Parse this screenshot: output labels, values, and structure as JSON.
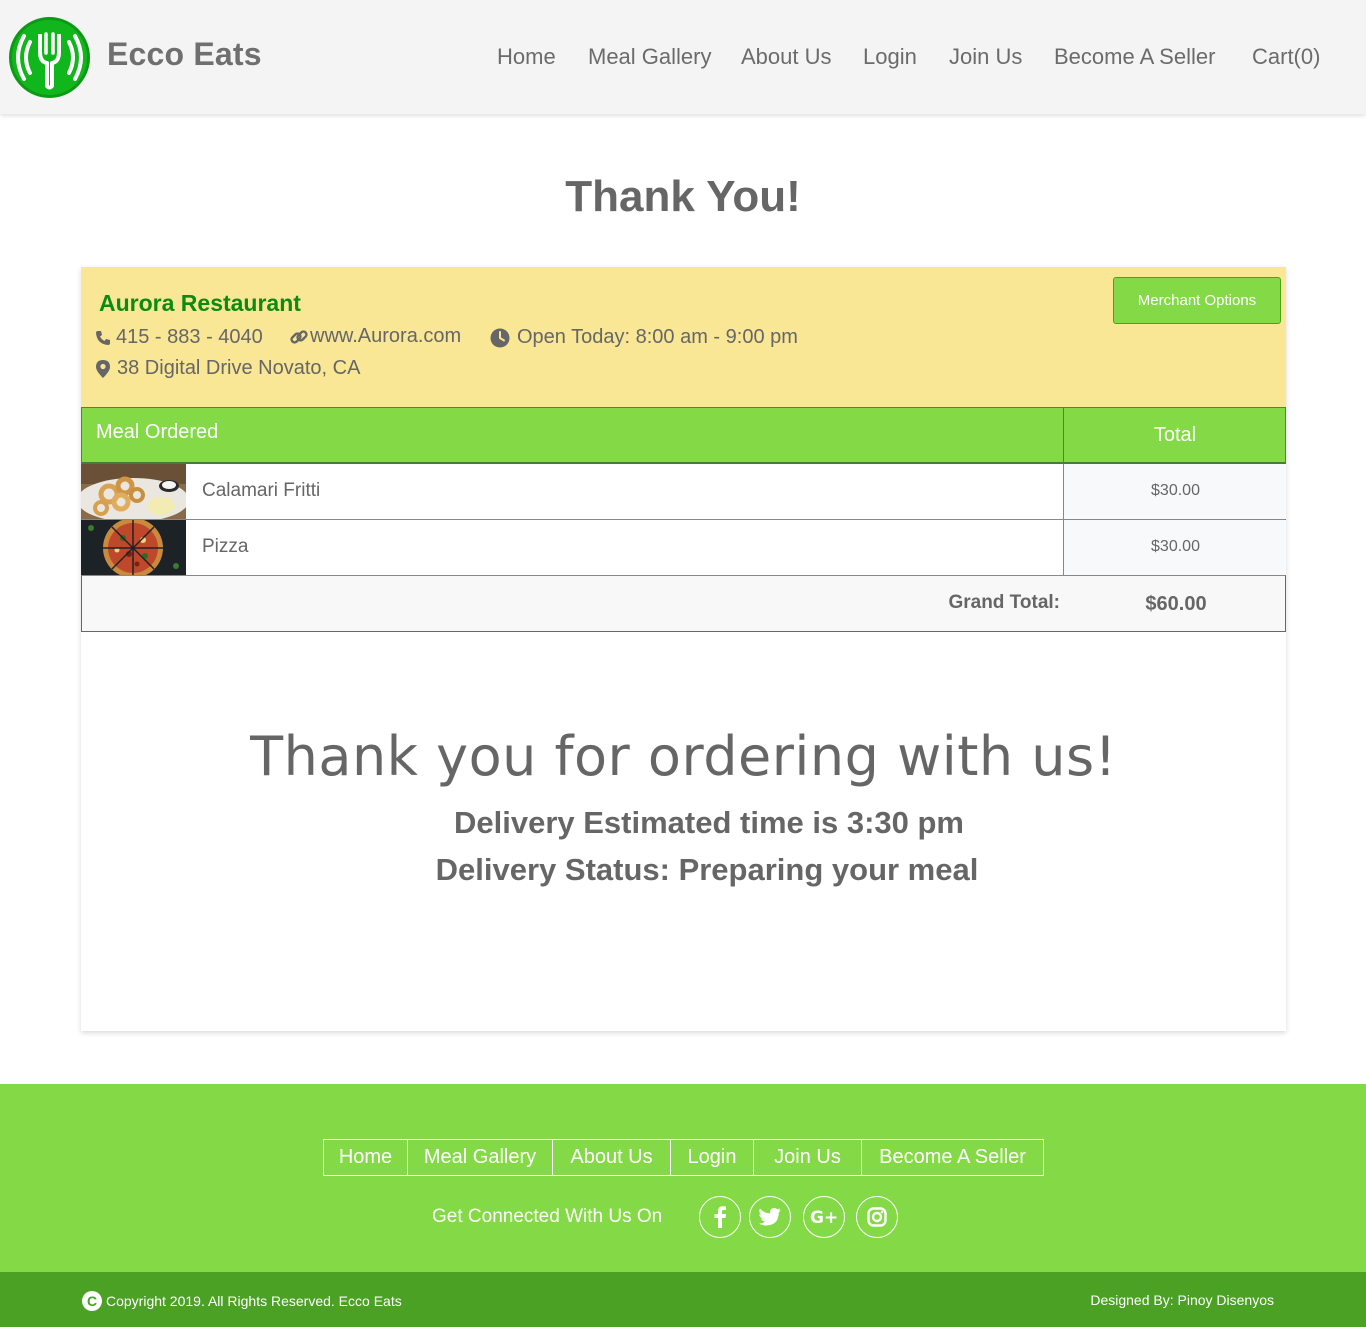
{
  "header": {
    "brand": "Ecco Eats",
    "nav": [
      "Home",
      "Meal Gallery",
      "About Us",
      "Login",
      "Join Us",
      "Become A Seller",
      "Cart(0)"
    ]
  },
  "page_title": "Thank You!",
  "merchant": {
    "name": "Aurora Restaurant",
    "phone": "415 - 883 - 4040",
    "website": "www.Aurora.com",
    "hours": "Open Today: 8:00 am - 9:00 pm",
    "address": "38 Digital Drive Novato, CA",
    "options_button": "Merchant Options"
  },
  "order": {
    "col_meal": "Meal Ordered",
    "col_total": "Total",
    "items": [
      {
        "name": "Calamari Fritti",
        "price": "$30.00"
      },
      {
        "name": "Pizza",
        "price": "$30.00"
      }
    ],
    "grand_label": "Grand Total:",
    "grand_value": "$60.00"
  },
  "confirmation": {
    "thanks": "Thank you for ordering with us!",
    "eta": "Delivery Estimated time is 3:30 pm",
    "status": "Delivery Status: Preparing your meal"
  },
  "footer": {
    "nav": [
      "Home",
      "Meal Gallery",
      "About Us",
      "Login",
      "Join Us",
      "Become A Seller"
    ],
    "connect": "Get Connected With Us On",
    "social": [
      "facebook-icon",
      "twitter-icon",
      "google-plus-icon",
      "instagram-icon"
    ],
    "copyright": "Copyright 2019. All Rights Reserved. Ecco Eats",
    "designed_by": "Designed By: Pinoy Disenyos"
  },
  "colors": {
    "brand_green": "#11b51c",
    "accent_green": "#84d946",
    "dark_green": "#4aa123",
    "merchant_bg": "#f9e795",
    "merchant_name": "#0d8a12"
  }
}
